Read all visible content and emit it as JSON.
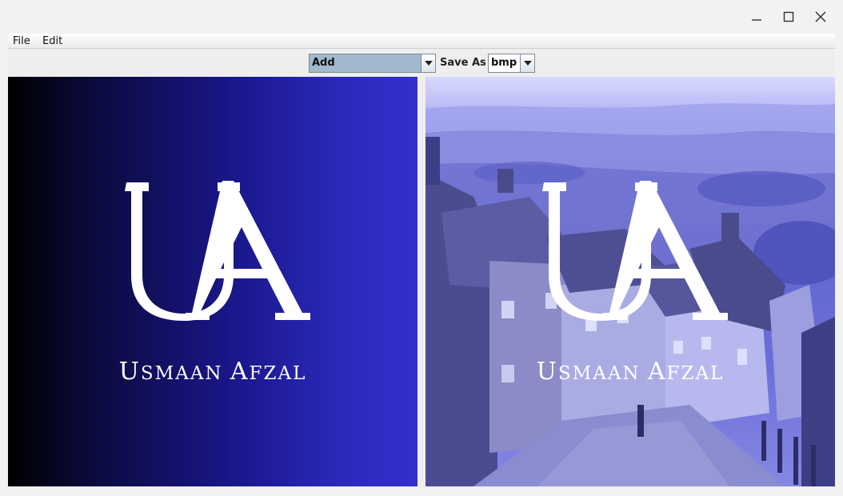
{
  "menu": {
    "file": "File",
    "edit": "Edit"
  },
  "toolbar": {
    "operation_value": "Add",
    "save_as_label": "Save As",
    "format_value": "bmp"
  },
  "logo": {
    "initials": "UA",
    "name_parts": [
      {
        "first": "U",
        "rest": "SMAAN "
      },
      {
        "first": "A",
        "rest": "FZAL"
      }
    ]
  },
  "colors": {
    "selection": "#a3b8cc",
    "left_gradient_end": "#3330cc",
    "right_tint": "#6468d2"
  },
  "icons": {
    "minimize": "minimize-icon",
    "maximize": "maximize-icon",
    "close": "close-icon",
    "dropdown": "chevron-down-icon"
  }
}
